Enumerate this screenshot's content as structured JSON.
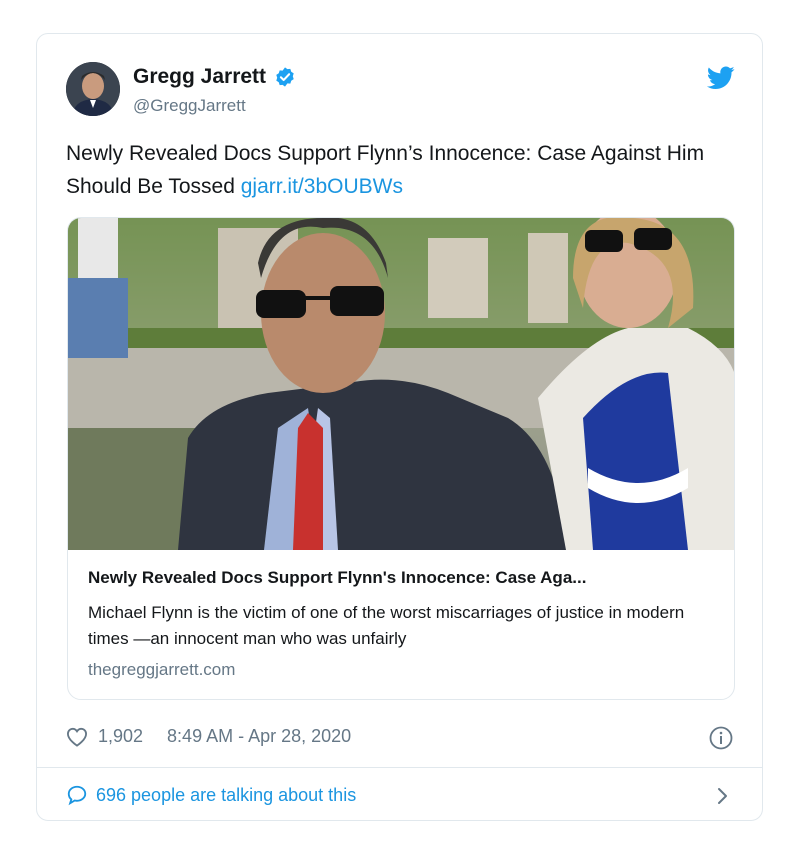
{
  "author": {
    "name": "Gregg Jarrett",
    "handle": "@GreggJarrett",
    "verified": true
  },
  "tweet": {
    "text": "Newly Revealed Docs Support Flynn’s Innocence: Case Against Him Should Be Tossed",
    "link": "gjarr.it/3bOUBWs"
  },
  "card": {
    "title": "Newly Revealed Docs Support Flynn's Innocence: Case Aga...",
    "description": "Michael Flynn is the victim of one of the worst miscarriages of justice in modern times —an innocent man who was unfairly",
    "domain": "thegreggjarrett.com"
  },
  "meta": {
    "likes": "1,902",
    "timestamp": "8:49 AM - Apr 28, 2020"
  },
  "footer": {
    "talking": "696 people are talking about this"
  },
  "colors": {
    "link_blue": "#1b95e0",
    "verified_blue": "#1da1f2",
    "muted_gray": "#657786",
    "border": "#e1e8ed"
  },
  "icons": [
    "verified-badge-icon",
    "twitter-bird-icon",
    "heart-icon",
    "info-icon",
    "reply-bubble-icon",
    "chevron-right-icon"
  ]
}
